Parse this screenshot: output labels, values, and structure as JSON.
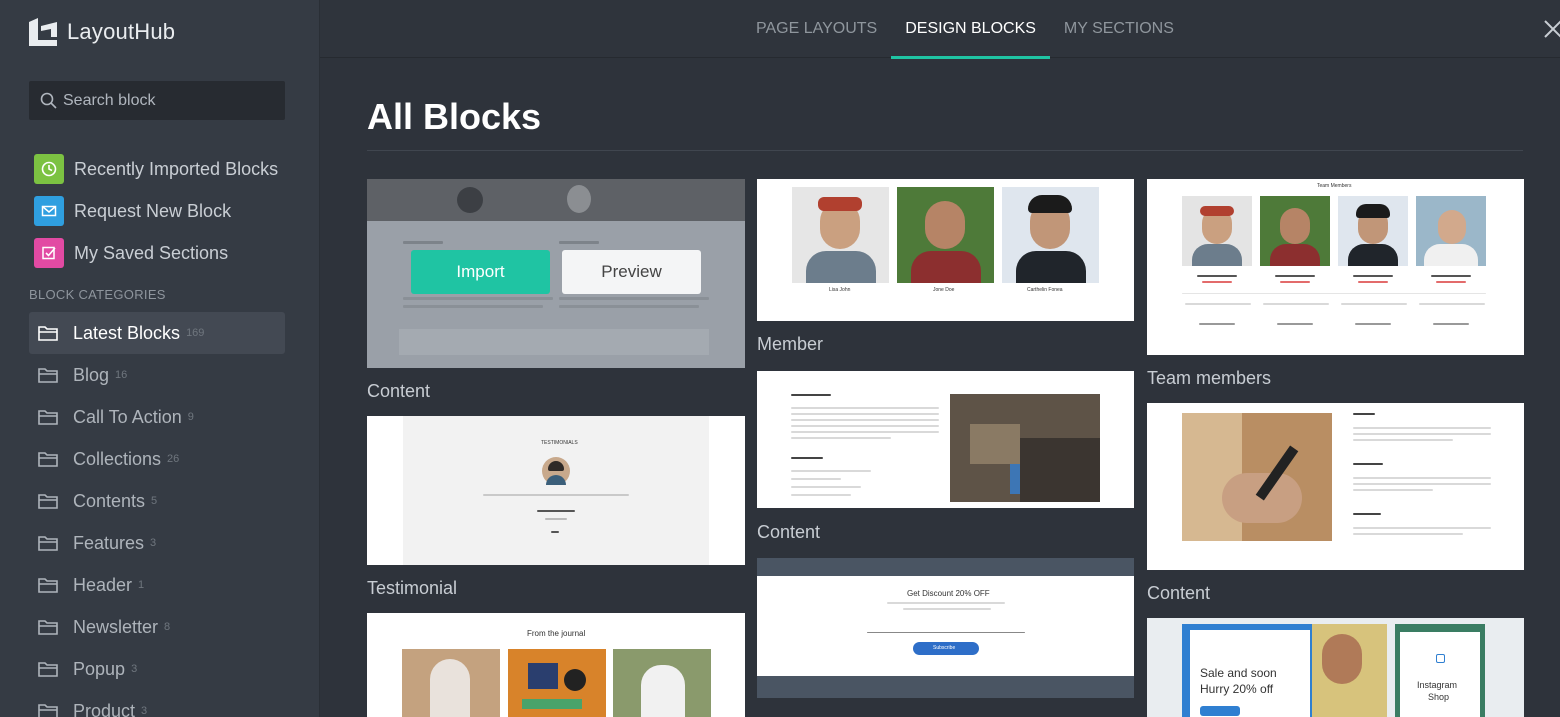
{
  "brand": {
    "name": "LayoutHub"
  },
  "search": {
    "placeholder": "Search block"
  },
  "quick_links": [
    {
      "label": "Recently Imported Blocks",
      "icon": "clock-icon",
      "color": "#7cc242"
    },
    {
      "label": "Request New Block",
      "icon": "mail-icon",
      "color": "#2f9fe0"
    },
    {
      "label": "My Saved Sections",
      "icon": "check-square-icon",
      "color": "#e24aa3"
    }
  ],
  "categories": {
    "heading": "BLOCK CATEGORIES",
    "items": [
      {
        "label": "Latest Blocks",
        "count": "169",
        "active": true
      },
      {
        "label": "Blog",
        "count": "16"
      },
      {
        "label": "Call To Action",
        "count": "9"
      },
      {
        "label": "Collections",
        "count": "26"
      },
      {
        "label": "Contents",
        "count": "5"
      },
      {
        "label": "Features",
        "count": "3"
      },
      {
        "label": "Header",
        "count": "1"
      },
      {
        "label": "Newsletter",
        "count": "8"
      },
      {
        "label": "Popup",
        "count": "3"
      },
      {
        "label": "Product",
        "count": "3"
      }
    ]
  },
  "tabs": [
    {
      "label": "PAGE LAYOUTS"
    },
    {
      "label": "DESIGN BLOCKS",
      "active": true
    },
    {
      "label": "MY SECTIONS"
    }
  ],
  "main": {
    "title": "All Blocks",
    "overlay": {
      "import_label": "Import",
      "preview_label": "Preview"
    },
    "cards": [
      {
        "caption": "Content"
      },
      {
        "caption": "Testimonial"
      },
      {
        "caption": "Member"
      },
      {
        "caption": "Content"
      },
      {
        "caption": "Team members"
      },
      {
        "caption": "Content"
      }
    ],
    "thumb_text": {
      "testimonial_heading": "TESTIMONIALS",
      "journal_heading": "From the journal",
      "discount_heading": "Get Discount 20% OFF",
      "subscribe_label": "Subscribe",
      "team_heading": "Team Members",
      "sale_line1": "Sale and soon",
      "sale_line2": "Hurry 20% off",
      "insta_line1": "Instagram",
      "insta_line2": "Shop",
      "member_names": [
        "Lisa John",
        "Jone Doe",
        "Carthelin Fonea"
      ]
    }
  },
  "colors": {
    "accent": "#1fc4a3",
    "sidebar_bg": "#353b44",
    "main_bg": "#2e333b"
  }
}
